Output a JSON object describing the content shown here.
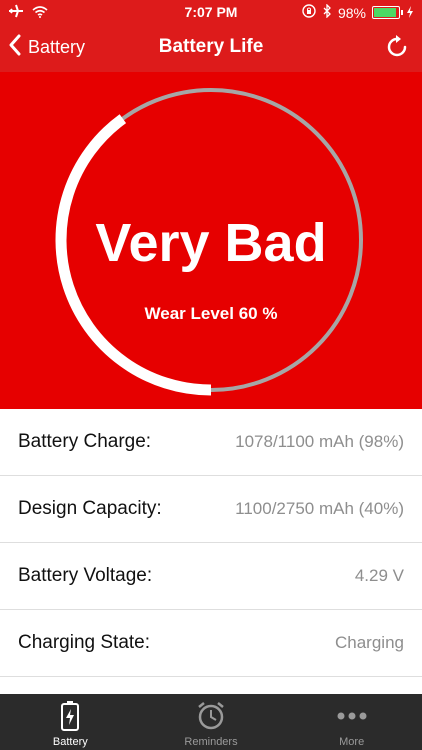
{
  "status_bar": {
    "time": "7:07 PM",
    "battery_percent": "98%",
    "battery_level": 0.98,
    "icons": [
      "airplane-icon",
      "wifi-icon",
      "orientation-lock-icon",
      "bluetooth-icon",
      "battery-icon",
      "charging-bolt-icon"
    ]
  },
  "nav": {
    "back_label": "Battery",
    "title": "Battery Life",
    "refresh_icon": "refresh-icon"
  },
  "hero": {
    "status": "Very Bad",
    "wear_text": "Wear Level 60 %",
    "health_fraction": 0.4,
    "colors": {
      "background": "#e60000",
      "progress": "#ffffff",
      "track": "#a6a6a6"
    }
  },
  "details": [
    {
      "label": "Battery Charge:",
      "value": "1078/1100 mAh (98%)"
    },
    {
      "label": "Design Capacity:",
      "value": "1100/2750 mAh (40%)"
    },
    {
      "label": "Battery Voltage:",
      "value": "4.29 V"
    },
    {
      "label": "Charging State:",
      "value": "Charging"
    }
  ],
  "tabs": [
    {
      "label": "Battery",
      "icon": "battery-tab-icon",
      "active": true
    },
    {
      "label": "Reminders",
      "icon": "alarm-clock-icon",
      "active": false
    },
    {
      "label": "More",
      "icon": "more-dots-icon",
      "active": false
    }
  ]
}
